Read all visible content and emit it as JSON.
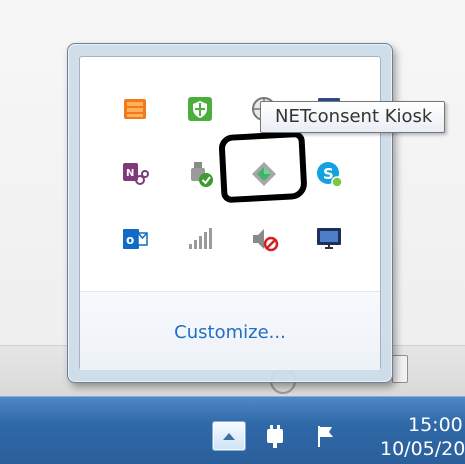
{
  "tooltip": {
    "text": "NETconsent Kiosk"
  },
  "overflow_area": {
    "customize_label": "Customize...",
    "icons": [
      "office-upload-icon",
      "security-shield-icon",
      "update-globe-icon",
      "display-icon",
      "onenote-clipper-icon",
      "safely-remove-hardware-icon",
      "netconsent-kiosk-icon",
      "skype-icon",
      "outlook-icon",
      "network-signal-icon",
      "volume-muted-icon",
      "display-settings-icon"
    ]
  },
  "taskbar": {
    "show_hidden_icon": "chevron-up-icon",
    "clock_time": "15:00",
    "clock_date": "10/05/20"
  },
  "colors": {
    "taskbar": "#2f69a8",
    "link": "#1f6fc4",
    "highlight": "#000000"
  }
}
